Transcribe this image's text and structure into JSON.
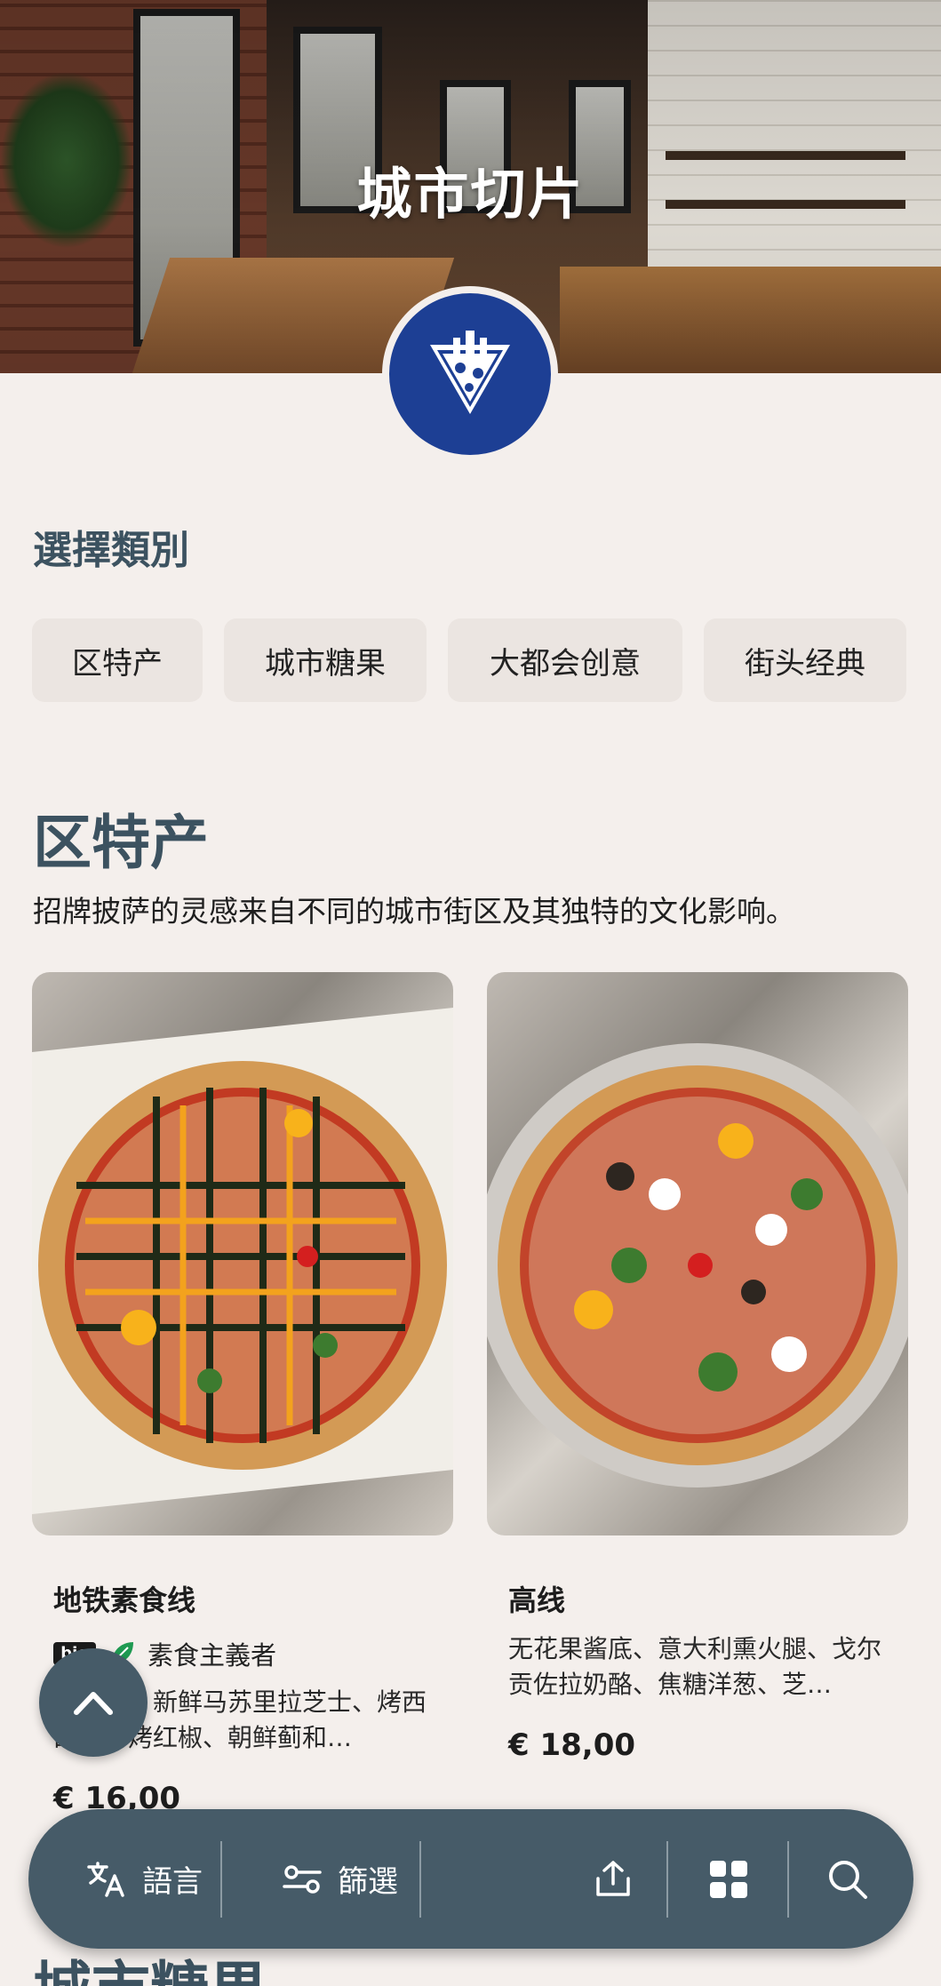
{
  "hero": {
    "title": "城市切片"
  },
  "categories": {
    "label": "選擇類別",
    "chips": [
      "区特产",
      "城市糖果",
      "大都会创意",
      "街头经典"
    ]
  },
  "section": {
    "heading": "区特产",
    "description": "招牌披萨的灵感来自不同的城市街区及其独特的文化影响。"
  },
  "items": [
    {
      "name": "地铁素食线",
      "badge": "bio",
      "tag": "素食主義者",
      "description": "番茄底、新鲜马苏里拉芝士、烤西葫芦、烤红椒、朝鲜蓟和…",
      "price": "€ 16,00"
    },
    {
      "name": "高线",
      "description": "无花果酱底、意大利熏火腿、戈尔贡佐拉奶酪、焦糖洋葱、芝…",
      "price": "€ 18,00"
    }
  ],
  "next_section": {
    "heading": "城市糖果"
  },
  "bottom_bar": {
    "language_label": "語言",
    "filter_label": "篩選",
    "icons": [
      "share-icon",
      "grid-icon",
      "search-icon"
    ]
  },
  "colors": {
    "bar": "#465b68",
    "heading": "#3c5260",
    "logo": "#1d3f94",
    "background": "#f4efec"
  }
}
